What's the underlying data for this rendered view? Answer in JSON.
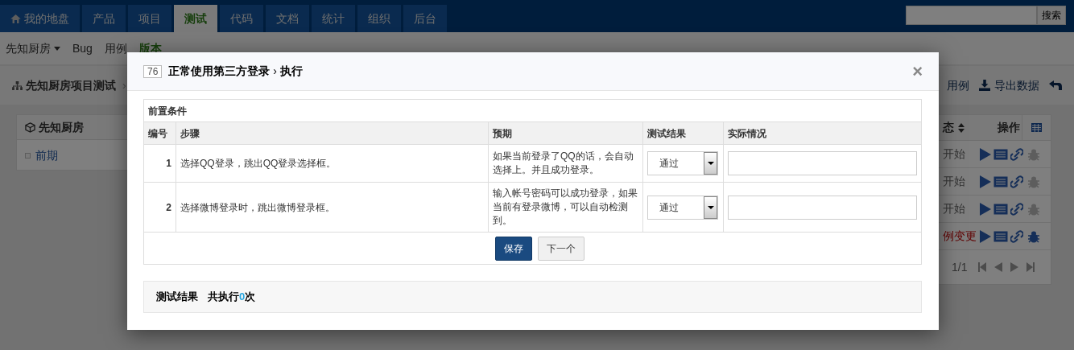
{
  "top_nav": {
    "tabs": [
      {
        "label": "我的地盘",
        "selected": false
      },
      {
        "label": "产品",
        "selected": false
      },
      {
        "label": "项目",
        "selected": false
      },
      {
        "label": "测试",
        "selected": true
      },
      {
        "label": "代码",
        "selected": false
      },
      {
        "label": "文档",
        "selected": false
      },
      {
        "label": "统计",
        "selected": false
      },
      {
        "label": "组织",
        "selected": false
      },
      {
        "label": "后台",
        "selected": false
      }
    ],
    "search_button": "搜索"
  },
  "sub_nav": [
    {
      "label": "先知厨房",
      "kind": "dropdown",
      "selected": false
    },
    {
      "label": "Bug",
      "kind": "link",
      "selected": false
    },
    {
      "label": "用例",
      "kind": "link",
      "selected": false
    },
    {
      "label": "版本",
      "kind": "link",
      "selected": true
    }
  ],
  "breadcrumb": {
    "title": "先知厨房项目测试",
    "separator": "›"
  },
  "toolbar": [
    {
      "label": "用例"
    },
    {
      "label": "导出数据"
    }
  ],
  "sidebar": {
    "title": "先知厨房",
    "items": [
      "前期"
    ]
  },
  "case_table": {
    "columns": [
      "态",
      "操作"
    ],
    "rows": [
      {
        "status": "开始",
        "kind": "normal",
        "bug_active": false
      },
      {
        "status": "开始",
        "kind": "normal",
        "bug_active": false
      },
      {
        "status": "开始",
        "kind": "normal",
        "bug_active": false
      },
      {
        "status": "例变更",
        "kind": "changed",
        "bug_active": true
      }
    ],
    "pager": "1/1"
  },
  "dialog": {
    "id": "76",
    "title": "正常使用第三方登录",
    "separator": "›",
    "action": "执行",
    "close": "×",
    "precondition_label": "前置条件",
    "columns": [
      "编号",
      "步骤",
      "预期",
      "测试结果",
      "实际情况"
    ],
    "steps": [
      {
        "number": "1",
        "step": "选择QQ登录，跳出QQ登录选择框。",
        "expect": "如果当前登录了QQ的话，会自动选择上。并且成功登录。",
        "result": "通过"
      },
      {
        "number": "2",
        "step": "选择微博登录时，跳出微博登录框。",
        "expect": "输入帐号密码可以成功登录，如果当前有登录微博，可以自动检测到。",
        "result": "通过"
      }
    ],
    "buttons": [
      {
        "label": "保存",
        "kind": "primary"
      },
      {
        "label": "下一个",
        "kind": "default"
      }
    ],
    "results": {
      "label": "测试结果",
      "count_prefix": "共执行",
      "count": "0",
      "count_suffix": "次"
    }
  }
}
